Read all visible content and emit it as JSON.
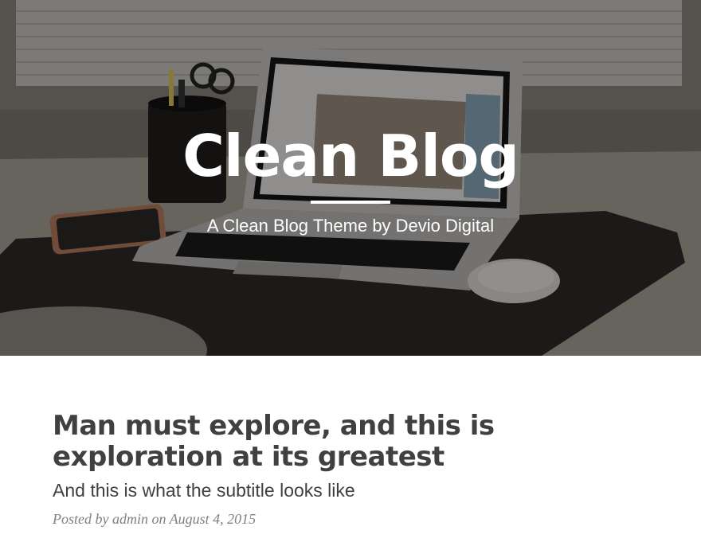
{
  "header": {
    "title": "Clean Blog",
    "subtitle": "A Clean Blog Theme by Devio Digital",
    "background_icon": "desk-laptop-photo"
  },
  "posts": [
    {
      "title": "Man must explore, and this is exploration at its greatest",
      "subtitle": "And this is what the subtitle looks like",
      "meta_prefix": "Posted by",
      "author": "admin",
      "meta_on": "on",
      "date": "August 4, 2015"
    }
  ],
  "colors": {
    "text": "#404040",
    "meta": "#808080",
    "hero_text": "#ffffff"
  }
}
